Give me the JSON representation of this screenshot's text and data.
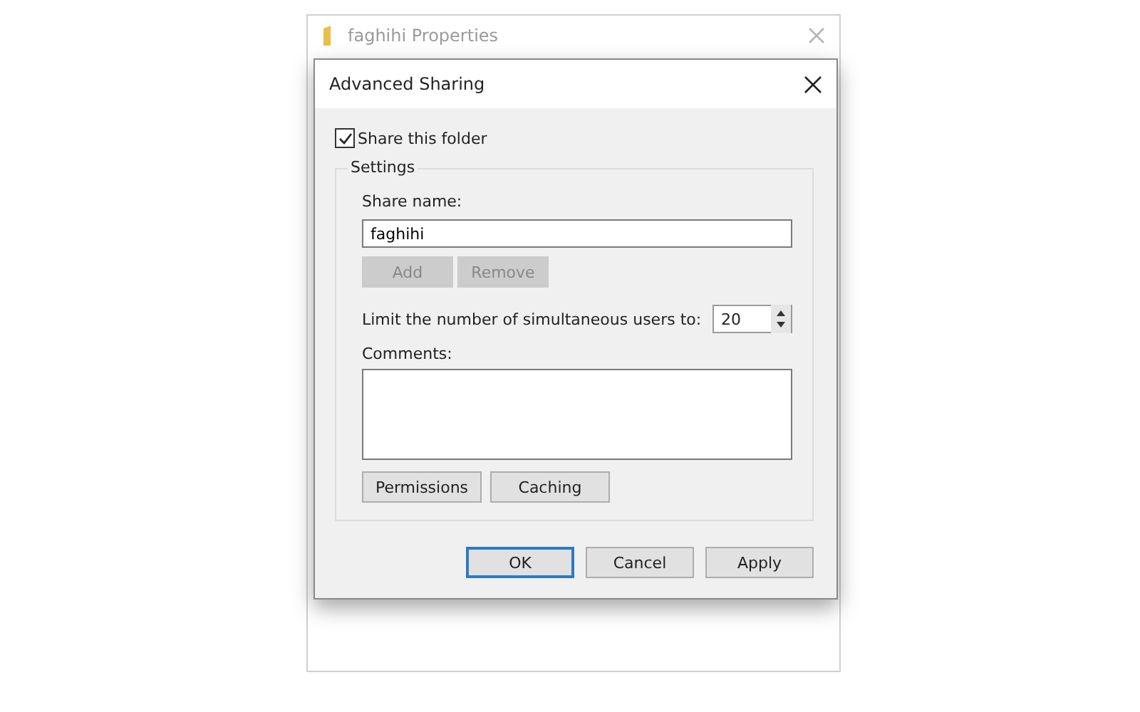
{
  "parent_window": {
    "title": "faghihi Properties"
  },
  "dialog": {
    "title": "Advanced Sharing",
    "share_checkbox": {
      "label": "Share this folder",
      "checked": true
    },
    "settings": {
      "legend": "Settings",
      "share_name_label": "Share name:",
      "share_name_value": "faghihi",
      "name_buttons": [
        {
          "label": "Add",
          "disabled": true
        },
        {
          "label": "Remove",
          "disabled": true
        }
      ],
      "limit_label": "Limit the number of simultaneous users to:",
      "limit_value": "20",
      "comments_label": "Comments:",
      "buttons": [
        {
          "label": "Permissions",
          "disabled": false
        },
        {
          "label": "Caching",
          "disabled": false
        }
      ]
    },
    "footer_buttons": [
      {
        "label": "OK",
        "default": true
      },
      {
        "label": "Cancel",
        "default": false
      },
      {
        "label": "Apply",
        "default": false
      }
    ]
  }
}
